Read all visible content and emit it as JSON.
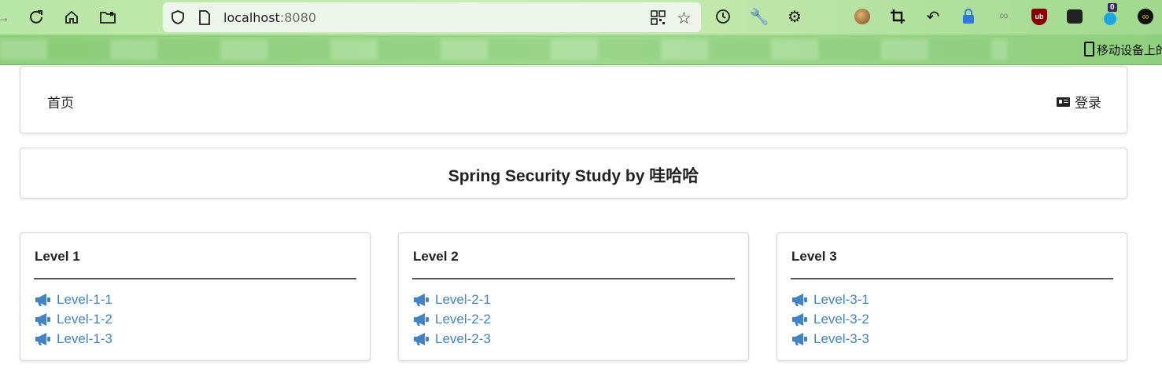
{
  "browser": {
    "url_host": "localhost",
    "url_port": ":8080",
    "bookmark_mobile": "移动设备上的",
    "ext_badge": "0",
    "ext_ub": "ub"
  },
  "nav": {
    "home": "首页",
    "login": "登录"
  },
  "hero": {
    "title": "Spring Security Study by 哇哈哈"
  },
  "levels": [
    {
      "title": "Level 1",
      "links": [
        "Level-1-1",
        "Level-1-2",
        "Level-1-3"
      ]
    },
    {
      "title": "Level 2",
      "links": [
        "Level-2-1",
        "Level-2-2",
        "Level-2-3"
      ]
    },
    {
      "title": "Level 3",
      "links": [
        "Level-3-1",
        "Level-3-2",
        "Level-3-3"
      ]
    }
  ],
  "colors": {
    "link": "#4183c4",
    "toolbar": "#b8e6a6",
    "bookmarks": "#8ed07c"
  }
}
